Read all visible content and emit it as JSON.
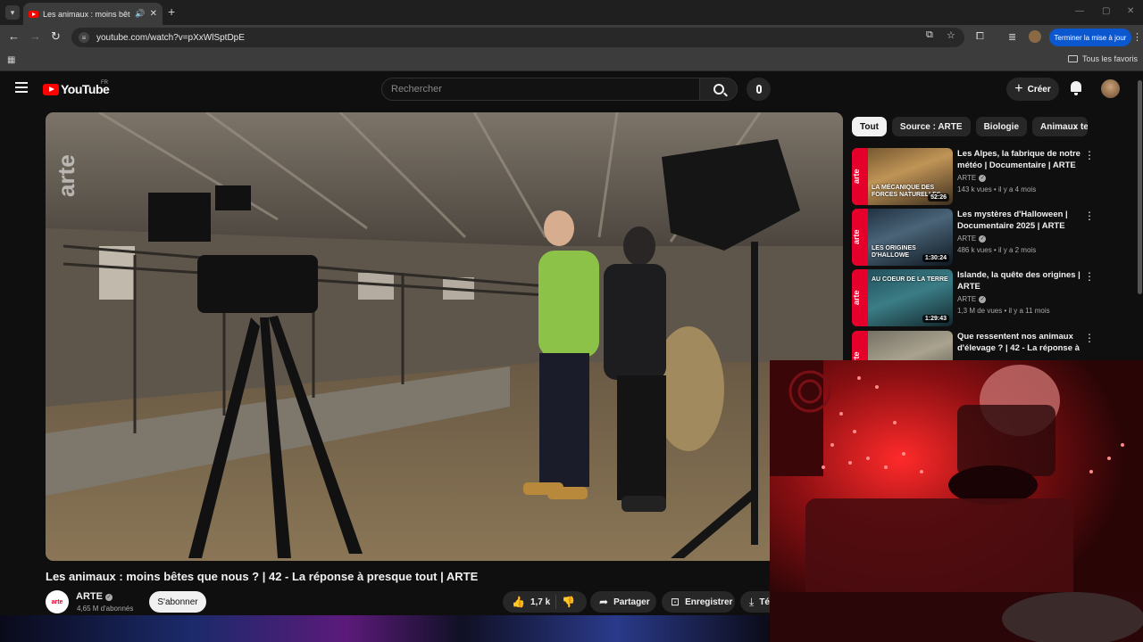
{
  "browser": {
    "tab_title": "Les animaux : moins bêtes que nous ?",
    "new_tab": "+",
    "url": "youtube.com/watch?v=pXxWlSptDpE",
    "update_button": "Terminer la mise à jour",
    "all_bookmarks": "Tous les favoris"
  },
  "header": {
    "logo_text": "YouTube",
    "country_code": "FR",
    "search_placeholder": "Rechercher",
    "create_label": "Créer"
  },
  "video": {
    "watermark": "arte",
    "title": "Les animaux : moins bêtes que nous ? | 42 - La réponse à presque tout | ARTE",
    "channel_avatar_text": "arte",
    "channel_name": "ARTE",
    "subscriber_count": "4,65 M d'abonnés",
    "subscribe_label": "S'abonner",
    "like_count": "1,7 k",
    "share_label": "Partager",
    "save_label": "Enregistrer",
    "download_label": "Té"
  },
  "chips": [
    "Tout",
    "Source : ARTE",
    "Biologie",
    "Animaux terrestres"
  ],
  "recommendations": [
    {
      "title": "Les Alpes, la fabrique de notre météo | Documentaire | ARTE",
      "channel": "ARTE",
      "views": "143 k vues",
      "age": "il y a 4 mois",
      "duration": "52:26",
      "thumb_text": "La mécanique des forces naturelles"
    },
    {
      "title": "Les mystères d'Halloween | Documentaire 2025 | ARTE",
      "channel": "ARTE",
      "views": "486 k vues",
      "age": "il y a 2 mois",
      "duration": "1:30:24",
      "thumb_text": "Les origines d'Hallowe"
    },
    {
      "title": "Islande, la quête des origines | ARTE",
      "channel": "ARTE",
      "views": "1,3 M de vues",
      "age": "il y a 11 mois",
      "duration": "1:29:43",
      "thumb_text": "Au coeur de la terre"
    },
    {
      "title": "Que ressentent nos animaux d'élevage ? | 42 - La réponse à ...",
      "channel": "ARTE",
      "views": "",
      "age": "",
      "duration": "",
      "thumb_text": ""
    }
  ],
  "colors": {
    "yt_red": "#ff0000",
    "arte_red": "#e4002b",
    "chrome_blue": "#0b57d0",
    "background": "#0f0f0f"
  }
}
